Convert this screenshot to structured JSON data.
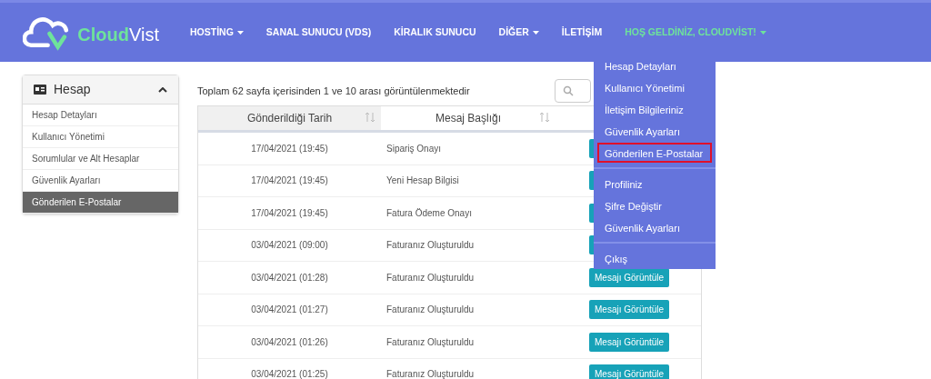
{
  "navbar": {
    "logo": {
      "part_1": "Cloud",
      "part_2": "Vist"
    },
    "items": [
      {
        "label": "HOSTİNG",
        "dropdown": true,
        "accent": false
      },
      {
        "label": "SANAL SUNUCU (VDS)",
        "dropdown": false,
        "accent": false
      },
      {
        "label": "KİRALIK SUNUCU",
        "dropdown": false,
        "accent": false
      },
      {
        "label": "DİĞER",
        "dropdown": true,
        "accent": false
      },
      {
        "label": "İLETİŞİM",
        "dropdown": false,
        "accent": false
      },
      {
        "label": "HOŞ GELDİNİZ, CLOUDVİST!",
        "dropdown": true,
        "accent": true
      }
    ]
  },
  "user_menu": {
    "groups": [
      [
        {
          "label": "Hesap Detayları",
          "highlighted": false
        },
        {
          "label": "Kullanıcı Yönetimi",
          "highlighted": false
        },
        {
          "label": "İletişim Bilgileriniz",
          "highlighted": false
        },
        {
          "label": "Güvenlik Ayarları",
          "highlighted": false
        },
        {
          "label": "Gönderilen E-Postalar",
          "highlighted": true
        }
      ],
      [
        {
          "label": "Profiliniz",
          "highlighted": false
        },
        {
          "label": "Şifre Değiştir",
          "highlighted": false
        },
        {
          "label": "Güvenlik Ayarları",
          "highlighted": false
        }
      ],
      [
        {
          "label": "Çıkış",
          "highlighted": false
        }
      ]
    ]
  },
  "sidebar": {
    "title": "Hesap",
    "expanded": true,
    "items": [
      {
        "label": "Hesap Detayları",
        "selected": false
      },
      {
        "label": "Kullanıcı Yönetimi",
        "selected": false
      },
      {
        "label": "Sorumlular ve Alt Hesaplar",
        "selected": false
      },
      {
        "label": "Güvenlik Ayarları",
        "selected": false
      },
      {
        "label": "Gönderilen E-Postalar",
        "selected": true
      }
    ]
  },
  "summary": "Toplam 62 sayfa içerisinden 1 ve 10 arası görüntülenmektedir",
  "table": {
    "columns": [
      "Gönderildiği Tarih",
      "Mesaj Başlığı"
    ],
    "rows": [
      {
        "date": "17/04/2021 (19:45)",
        "subject": "Sipariş Onayı"
      },
      {
        "date": "17/04/2021 (19:45)",
        "subject": "Yeni Hesap Bilgisi"
      },
      {
        "date": "17/04/2021 (19:45)",
        "subject": "Fatura Ödeme Onayı"
      },
      {
        "date": "03/04/2021 (09:00)",
        "subject": "Faturanız Oluşturuldu"
      },
      {
        "date": "03/04/2021 (01:28)",
        "subject": "Faturanız Oluşturuldu",
        "button": "Mesajı Görüntüle"
      },
      {
        "date": "03/04/2021 (01:27)",
        "subject": "Faturanız Oluşturuldu",
        "button": "Mesajı Görüntüle"
      },
      {
        "date": "03/04/2021 (01:26)",
        "subject": "Faturanız Oluşturuldu",
        "button": "Mesajı Görüntüle"
      },
      {
        "date": "03/04/2021 (01:25)",
        "subject": "Faturanız Oluşturuldu",
        "button": "Mesajı Görüntüle"
      }
    ]
  }
}
